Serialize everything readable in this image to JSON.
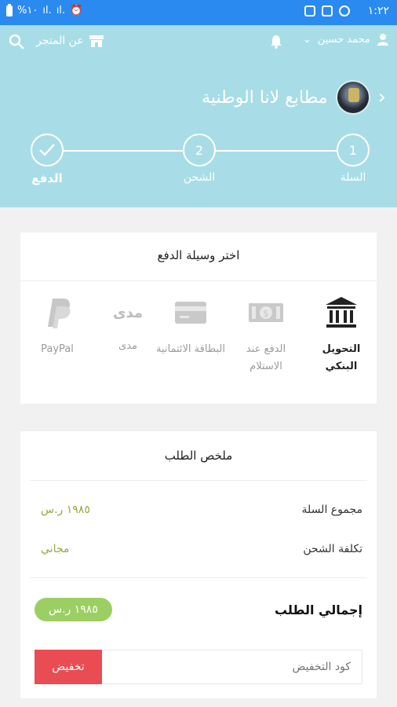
{
  "status_bar": {
    "time": "١:٢٢",
    "battery": "%١٠"
  },
  "header": {
    "store_link": "عن المتجر",
    "user_name": "محمد حسين",
    "shop_name": "مطابع لانا الوطنية",
    "steps": [
      {
        "number": "",
        "label": "الدفع",
        "state": "done"
      },
      {
        "number": "2",
        "label": "الشحن",
        "state": "pending"
      },
      {
        "number": "1",
        "label": "السلة",
        "state": "pending"
      }
    ]
  },
  "payment": {
    "title": "اختر وسيلة الدفع",
    "methods": [
      {
        "label": "PayPal",
        "icon": "paypal-icon",
        "active": false
      },
      {
        "label": "مدى",
        "icon": "mada-icon",
        "active": false
      },
      {
        "label": "البطاقة الائتمانية",
        "icon": "credit-card-icon",
        "active": false
      },
      {
        "label": "الدفع عند الاستلام",
        "icon": "cash-icon",
        "active": false
      },
      {
        "label": "التحويل البنكي",
        "icon": "bank-icon",
        "active": true
      }
    ],
    "mada_logo": "مدى"
  },
  "summary": {
    "title": "ملخص الطلب",
    "cart_total_label": "مجموع السلة",
    "cart_total_value": "١٩٨٥ ر.س",
    "shipping_label": "تكلفة الشحن",
    "shipping_value": "مجاني",
    "grand_total_label": "إجمالي الطلب",
    "grand_total_value": "١٩٨٥ ر.س",
    "coupon_placeholder": "كود التخفيض",
    "coupon_button": "تخفيض"
  },
  "colors": {
    "status_bar": "#2a8af0",
    "header": "#a8dde7",
    "price": "#9aa542",
    "total_pill": "#9ccf63",
    "coupon_button": "#e94c52"
  }
}
